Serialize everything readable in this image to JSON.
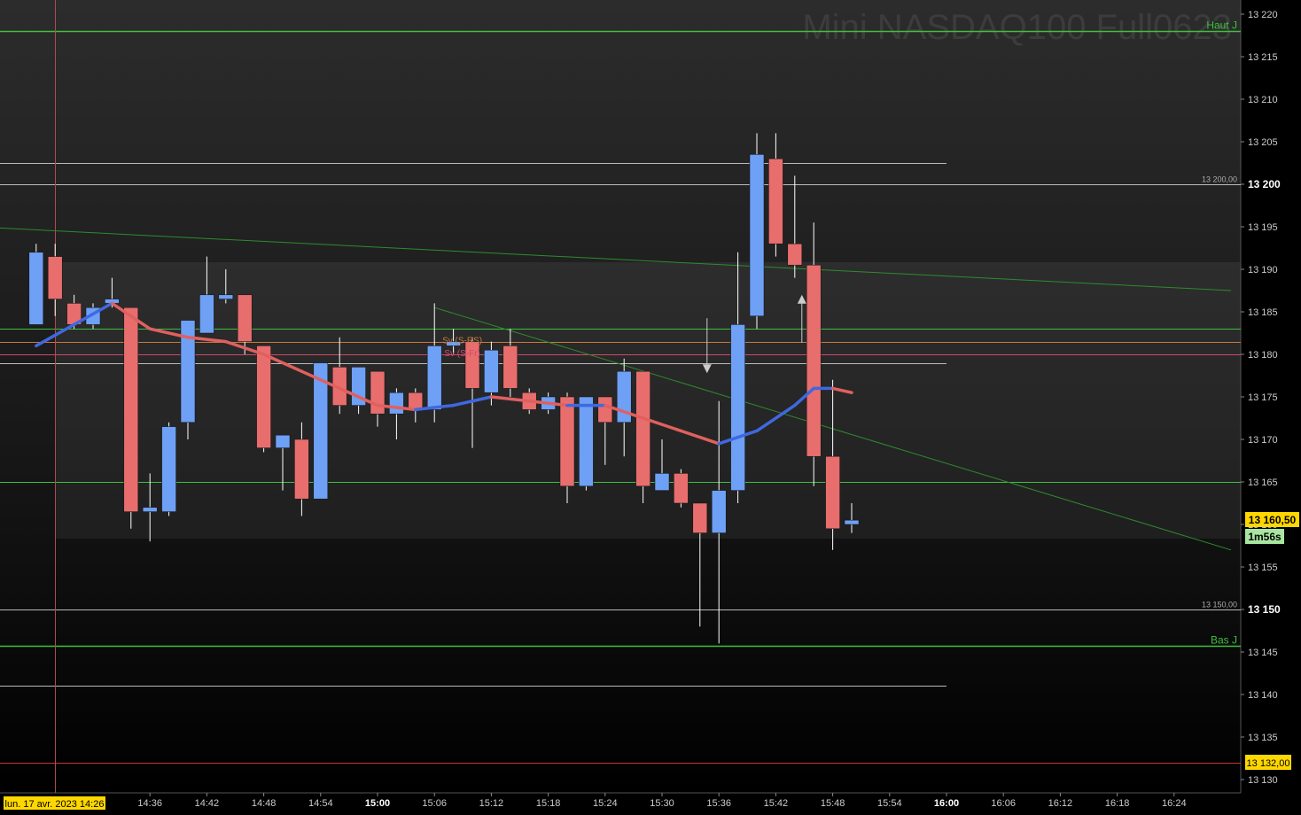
{
  "instrument_title": "Mini NASDAQ100 Full0623",
  "cursor_date_label": "lun. 17 avr. 2023 14:26",
  "countdown_label": "1m56s",
  "current_price_label": "13 160,50",
  "alert_price_label": "13 132,00",
  "colors": {
    "background_top": "#2b2b2b",
    "background_bottom": "#000000",
    "bull_candle": "#6ea0f5",
    "bear_candle": "#e86e6e",
    "moving_average_up": "#3f68e0",
    "moving_average_down": "#e06060",
    "level_green": "#3fbf3f",
    "price_badge_bg": "#ffd700",
    "countdown_bg": "#a8e6a0"
  },
  "chart_data": {
    "type": "candlestick",
    "title": "Mini NASDAQ100 Full0623",
    "timeframe_minutes": 2,
    "ylim": [
      13128,
      13222
    ],
    "y_ticks": [
      13130,
      13135,
      13140,
      13145,
      13150,
      13155,
      13160,
      13165,
      13170,
      13175,
      13180,
      13185,
      13190,
      13195,
      13200,
      13205,
      13210,
      13215,
      13220
    ],
    "y_tick_labels": [
      "13 130",
      "13 135",
      "13 140",
      "13 145",
      "13 150",
      "13 155",
      "13 160",
      "13 165",
      "13 170",
      "13 175",
      "13 180",
      "13 185",
      "13 190",
      "13 195",
      "13 200",
      "13 205",
      "13 210",
      "13 215",
      "13 220"
    ],
    "bold_y_ticks": [
      13150,
      13200
    ],
    "x_tick_labels": [
      "14:36",
      "14:42",
      "14:48",
      "14:54",
      "15:00",
      "15:06",
      "15:12",
      "15:18",
      "15:24",
      "15:30",
      "15:36",
      "15:42",
      "15:48",
      "15:54",
      "16:00",
      "16:06",
      "16:12",
      "16:18",
      "16:24"
    ],
    "bold_x_ticks": [
      "15:00",
      "16:00"
    ],
    "candles": [
      {
        "time": "14:24",
        "open": 13183.5,
        "high": 13193,
        "low": 13183.5,
        "close": 13192
      },
      {
        "time": "14:26",
        "open": 13191.5,
        "high": 13193,
        "low": 13184.5,
        "close": 13186.5
      },
      {
        "time": "14:28",
        "open": 13186,
        "high": 13187,
        "low": 13183,
        "close": 13183.5
      },
      {
        "time": "14:30",
        "open": 13183.5,
        "high": 13186,
        "low": 13183,
        "close": 13185.5
      },
      {
        "time": "14:32",
        "open": 13186,
        "high": 13189,
        "low": 13185.5,
        "close": 13186.5
      },
      {
        "time": "14:34",
        "open": 13185.5,
        "high": 13185.5,
        "low": 13159.5,
        "close": 13161.5
      },
      {
        "time": "14:36",
        "open": 13161.5,
        "high": 13166,
        "low": 13158,
        "close": 13162
      },
      {
        "time": "14:38",
        "open": 13161.5,
        "high": 13172,
        "low": 13161,
        "close": 13171.5
      },
      {
        "time": "14:40",
        "open": 13172,
        "high": 13184,
        "low": 13170,
        "close": 13184
      },
      {
        "time": "14:42",
        "open": 13182.5,
        "high": 13191.5,
        "low": 13182.5,
        "close": 13187
      },
      {
        "time": "14:44",
        "open": 13186.5,
        "high": 13190,
        "low": 13186,
        "close": 13187
      },
      {
        "time": "14:46",
        "open": 13187,
        "high": 13187,
        "low": 13180,
        "close": 13181.5
      },
      {
        "time": "14:48",
        "open": 13181,
        "high": 13181,
        "low": 13168.5,
        "close": 13169
      },
      {
        "time": "14:50",
        "open": 13169,
        "high": 13170.5,
        "low": 13164,
        "close": 13170.5
      },
      {
        "time": "14:52",
        "open": 13170,
        "high": 13172,
        "low": 13161,
        "close": 13163
      },
      {
        "time": "14:54",
        "open": 13163,
        "high": 13179,
        "low": 13163,
        "close": 13179
      },
      {
        "time": "14:56",
        "open": 13178.5,
        "high": 13182,
        "low": 13173,
        "close": 13174
      },
      {
        "time": "14:58",
        "open": 13174,
        "high": 13178.5,
        "low": 13173,
        "close": 13178.5
      },
      {
        "time": "15:00",
        "open": 13178,
        "high": 13178,
        "low": 13171.5,
        "close": 13173
      },
      {
        "time": "15:02",
        "open": 13173,
        "high": 13176,
        "low": 13170,
        "close": 13175.5
      },
      {
        "time": "15:04",
        "open": 13175.5,
        "high": 13176,
        "low": 13172,
        "close": 13173.5
      },
      {
        "time": "15:06",
        "open": 13173.5,
        "high": 13186,
        "low": 13172,
        "close": 13181
      },
      {
        "time": "15:08",
        "open": 13181,
        "high": 13183,
        "low": 13180,
        "close": 13181.5
      },
      {
        "time": "15:10",
        "open": 13181.5,
        "high": 13182,
        "low": 13169,
        "close": 13176
      },
      {
        "time": "15:12",
        "open": 13175.5,
        "high": 13181.5,
        "low": 13174,
        "close": 13180.5
      },
      {
        "time": "15:14",
        "open": 13181,
        "high": 13183,
        "low": 13175,
        "close": 13176
      },
      {
        "time": "15:16",
        "open": 13175.5,
        "high": 13176,
        "low": 13173,
        "close": 13173.5
      },
      {
        "time": "15:18",
        "open": 13173.5,
        "high": 13175.5,
        "low": 13173,
        "close": 13175
      },
      {
        "time": "15:20",
        "open": 13175,
        "high": 13175.5,
        "low": 13162.5,
        "close": 13164.5
      },
      {
        "time": "15:22",
        "open": 13164.5,
        "high": 13175,
        "low": 13164,
        "close": 13175
      },
      {
        "time": "15:24",
        "open": 13175,
        "high": 13175,
        "low": 13167,
        "close": 13172
      },
      {
        "time": "15:26",
        "open": 13172,
        "high": 13179.5,
        "low": 13168,
        "close": 13178
      },
      {
        "time": "15:28",
        "open": 13178,
        "high": 13178,
        "low": 13162.5,
        "close": 13164.5
      },
      {
        "time": "15:30",
        "open": 13164,
        "high": 13170,
        "low": 13164,
        "close": 13166
      },
      {
        "time": "15:32",
        "open": 13166,
        "high": 13166.5,
        "low": 13162,
        "close": 13162.5
      },
      {
        "time": "15:34",
        "open": 13162.5,
        "high": 13162.5,
        "low": 13148,
        "close": 13159
      },
      {
        "time": "15:36",
        "open": 13159,
        "high": 13174.5,
        "low": 13146,
        "close": 13164
      },
      {
        "time": "15:38",
        "open": 13164,
        "high": 13192,
        "low": 13162.5,
        "close": 13183.5
      },
      {
        "time": "15:40",
        "open": 13184.5,
        "high": 13206,
        "low": 13183,
        "close": 13203.5
      },
      {
        "time": "15:42",
        "open": 13203,
        "high": 13206,
        "low": 13191.5,
        "close": 13193
      },
      {
        "time": "15:44",
        "open": 13193,
        "high": 13201,
        "low": 13189,
        "close": 13190.5
      },
      {
        "time": "15:46",
        "open": 13190.5,
        "high": 13195.5,
        "low": 13164.5,
        "close": 13168
      },
      {
        "time": "15:48",
        "open": 13168,
        "high": 13177,
        "low": 13157,
        "close": 13159.5
      },
      {
        "time": "15:50",
        "open": 13160,
        "high": 13162.5,
        "low": 13159,
        "close": 13160.5
      }
    ],
    "moving_average": [
      {
        "time": "14:24",
        "value": 13181
      },
      {
        "time": "14:28",
        "value": 13183.5
      },
      {
        "time": "14:32",
        "value": 13186
      },
      {
        "time": "14:36",
        "value": 13183
      },
      {
        "time": "14:40",
        "value": 13182
      },
      {
        "time": "14:44",
        "value": 13181.5
      },
      {
        "time": "14:48",
        "value": 13180
      },
      {
        "time": "14:52",
        "value": 13178
      },
      {
        "time": "14:56",
        "value": 13176
      },
      {
        "time": "15:00",
        "value": 13174
      },
      {
        "time": "15:04",
        "value": 13173.5
      },
      {
        "time": "15:08",
        "value": 13174
      },
      {
        "time": "15:12",
        "value": 13175
      },
      {
        "time": "15:16",
        "value": 13174.5
      },
      {
        "time": "15:20",
        "value": 13174
      },
      {
        "time": "15:24",
        "value": 13174
      },
      {
        "time": "15:28",
        "value": 13172.5
      },
      {
        "time": "15:32",
        "value": 13171
      },
      {
        "time": "15:36",
        "value": 13169.5
      },
      {
        "time": "15:40",
        "value": 13171
      },
      {
        "time": "15:44",
        "value": 13174
      },
      {
        "time": "15:46",
        "value": 13176
      },
      {
        "time": "15:48",
        "value": 13176
      },
      {
        "time": "15:50",
        "value": 13175.5
      }
    ],
    "horizontal_levels": [
      {
        "name": "haut-j",
        "price": 13218,
        "color": "#3fbf3f",
        "label": "Haut J",
        "span": "full"
      },
      {
        "name": "level-13202",
        "price": 13202.5,
        "color": "#bbbbbb",
        "label": "",
        "span": "partial"
      },
      {
        "name": "level-13200",
        "price": 13200,
        "color": "#bbbbbb",
        "label": "13 200,00",
        "span": "full"
      },
      {
        "name": "level-13183",
        "price": 13183,
        "color": "#3fbf3f",
        "label": "",
        "span": "full"
      },
      {
        "name": "level-13181",
        "price": 13181.5,
        "color": "#c8783c",
        "label": "",
        "span": "full"
      },
      {
        "name": "level-13180",
        "price": 13180,
        "color": "#cc4a6a",
        "label": "",
        "span": "full"
      },
      {
        "name": "level-13179",
        "price": 13179,
        "color": "#bbbbbb",
        "label": "",
        "span": "partial"
      },
      {
        "name": "level-13165",
        "price": 13165,
        "color": "#3fbf3f",
        "label": "",
        "span": "full"
      },
      {
        "name": "level-13150",
        "price": 13150,
        "color": "#bbbbbb",
        "label": "13 150,00",
        "span": "full"
      },
      {
        "name": "bas-j",
        "price": 13145.7,
        "color": "#3fbf3f",
        "label": "Bas J",
        "span": "full"
      },
      {
        "name": "level-13141",
        "price": 13141,
        "color": "#bbbbbb",
        "label": "",
        "span": "partial"
      },
      {
        "name": "alert-13132",
        "price": 13132,
        "color": "#cc3333",
        "label": "",
        "span": "full"
      }
    ],
    "trendlines": [
      {
        "name": "trendline-upper",
        "from": {
          "time": "14:00",
          "price": 13196
        },
        "to": {
          "time": "16:30",
          "price": 13187.5
        },
        "color": "#2e8b2e"
      },
      {
        "name": "trendline-lower",
        "from": {
          "time": "15:06",
          "price": 13185.5
        },
        "to": {
          "time": "16:30",
          "price": 13157
        },
        "color": "#2e8b2e"
      }
    ],
    "order_labels": [
      {
        "time": "15:08",
        "price": 13181.5,
        "text": "Sv (S-RS)",
        "color": "#c8783c"
      },
      {
        "time": "15:08",
        "price": 13180,
        "text": "Sv (S-Fr)",
        "color": "#cc4a6a"
      }
    ],
    "signals": [
      {
        "time": "15:34",
        "direction": "down",
        "price": 13178
      },
      {
        "time": "15:44",
        "direction": "up",
        "price": 13182
      }
    ],
    "current_price": 13160.5,
    "alert_price": 13132,
    "cursor_time": "14:26"
  }
}
